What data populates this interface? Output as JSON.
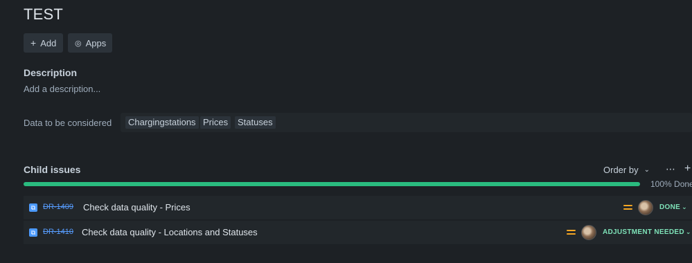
{
  "page": {
    "title": "TEST"
  },
  "toolbar": {
    "add_label": "Add",
    "apps_label": "Apps",
    "add_icon": "plus-icon",
    "apps_icon": "apps-icon"
  },
  "description": {
    "heading": "Description",
    "placeholder": "Add a description..."
  },
  "data_field": {
    "label": "Data to be considered",
    "tags": [
      "Chargingstations",
      "Prices",
      "Statuses"
    ]
  },
  "child_issues": {
    "heading": "Child issues",
    "order_by_label": "Order by",
    "progress_percent": 100,
    "progress_label": "100% Done",
    "issues": [
      {
        "key": "DR-1409",
        "summary": "Check data quality - Prices",
        "status": "DONE",
        "priority_icon": "priority-medium-icon"
      },
      {
        "key": "DR-1410",
        "summary": "Check data quality - Locations and Statuses",
        "status": "ADJUSTMENT NEEDED",
        "priority_icon": "priority-medium-icon"
      }
    ]
  },
  "colors": {
    "progress": "#2abb7f",
    "status_text": "#7ee2b8",
    "priority": "#f5a623"
  }
}
